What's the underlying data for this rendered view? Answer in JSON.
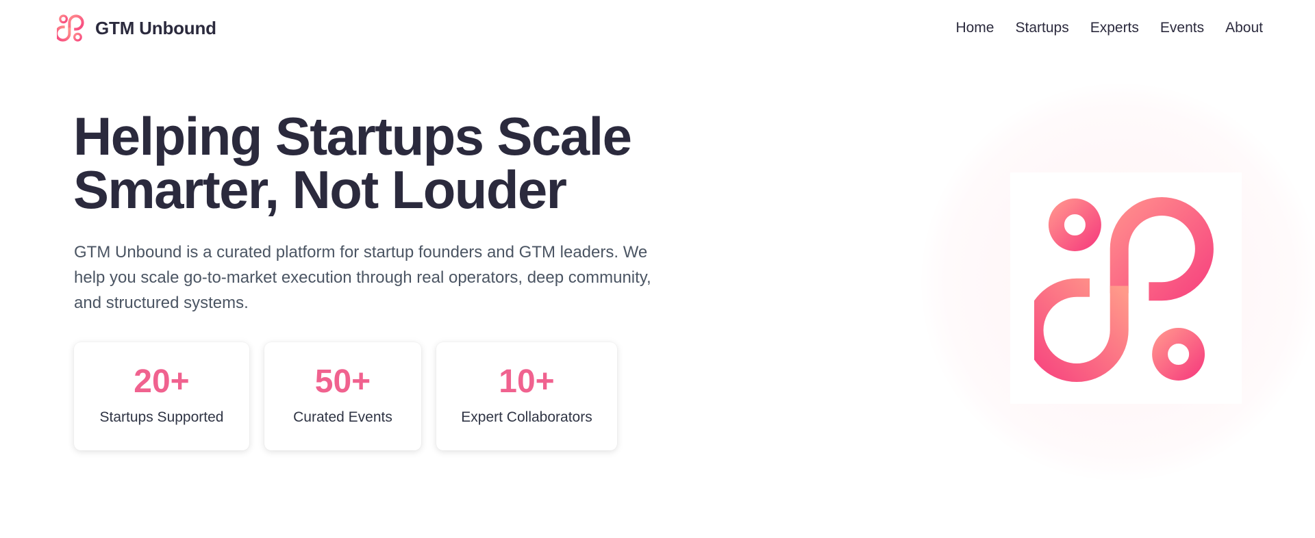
{
  "brand": {
    "name": "GTM Unbound",
    "logo_icon": "gtm-unbound-logo-icon",
    "accent_color": "#f0628f",
    "gradient_colors": [
      "#ff8c8c",
      "#f7457f"
    ]
  },
  "nav": {
    "items": [
      {
        "label": "Home"
      },
      {
        "label": "Startups"
      },
      {
        "label": "Experts"
      },
      {
        "label": "Events"
      },
      {
        "label": "About"
      }
    ]
  },
  "hero": {
    "title_line1": "Helping Startups Scale",
    "title_line2": "Smarter, Not Louder",
    "description": "GTM Unbound is a curated platform for startup founders and GTM leaders. We help you scale go-to-market execution through real operators, deep community, and structured systems.",
    "illustration_icon": "gtm-unbound-logo-icon"
  },
  "stats": [
    {
      "value": "20+",
      "label": "Startups Supported"
    },
    {
      "value": "50+",
      "label": "Curated Events"
    },
    {
      "value": "10+",
      "label": "Expert Collaborators"
    }
  ]
}
